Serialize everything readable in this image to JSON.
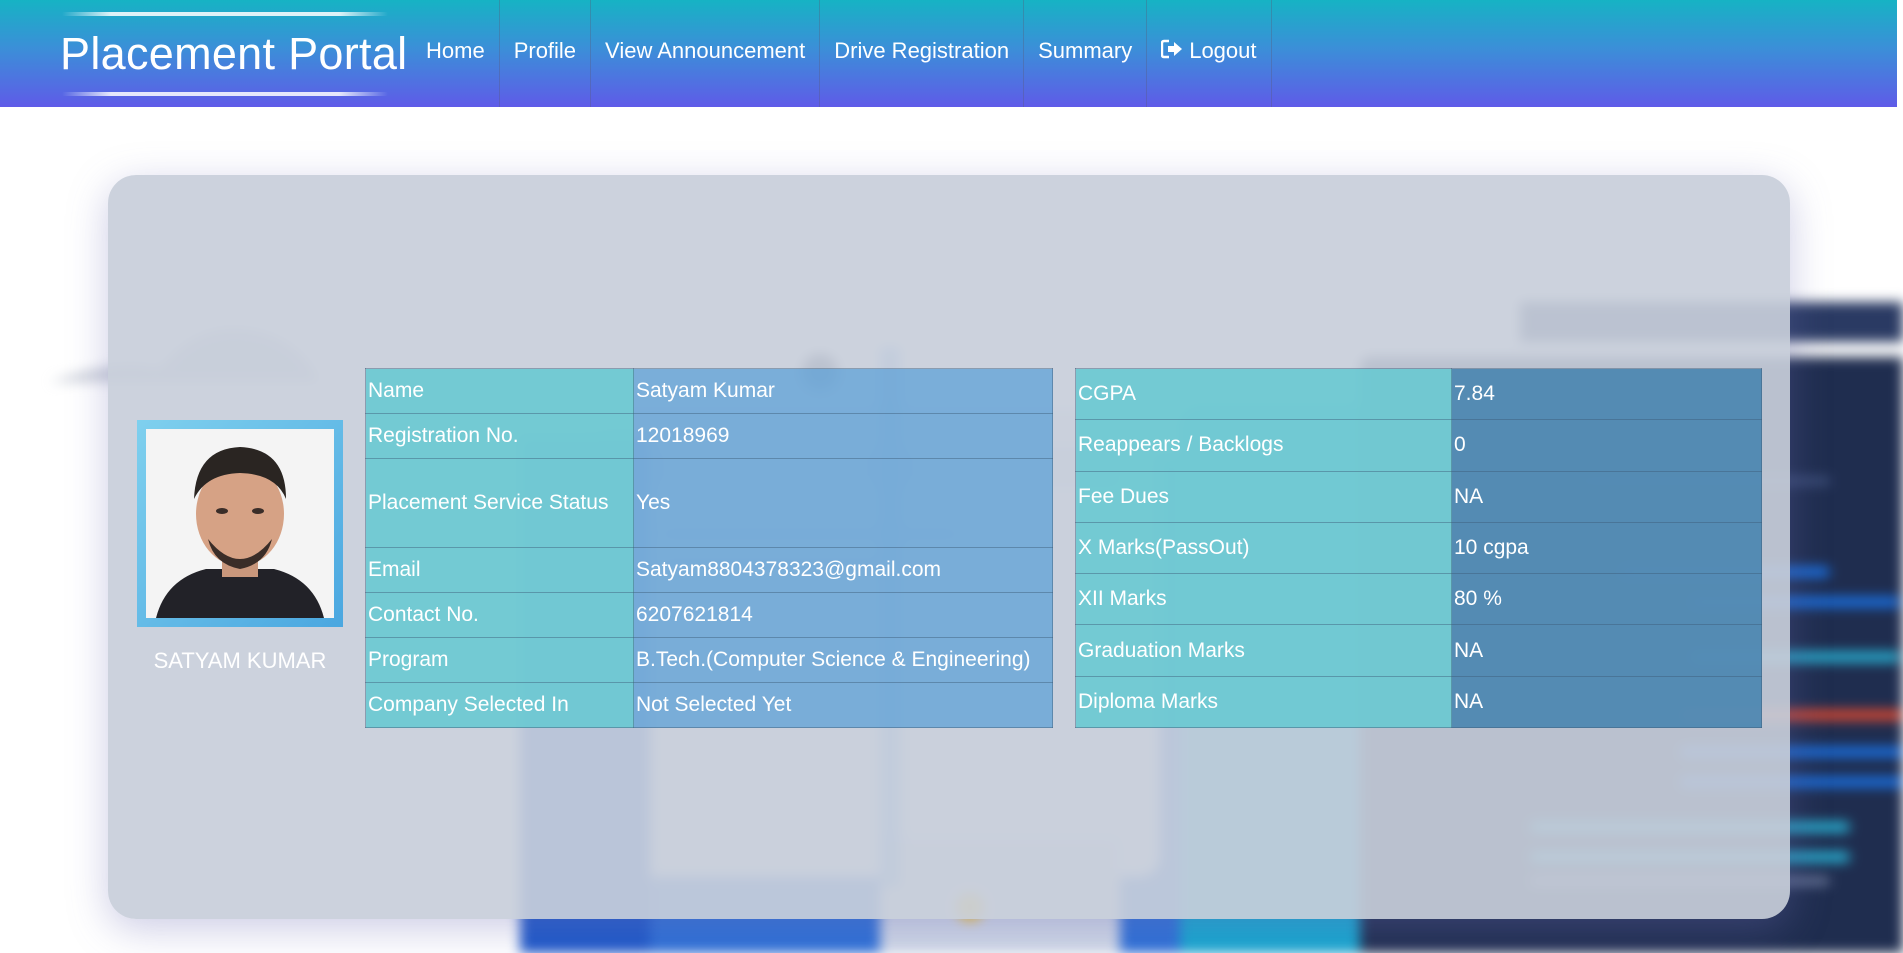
{
  "navbar": {
    "brand": "Placement Portal",
    "items": [
      {
        "label": "Home"
      },
      {
        "label": "Profile"
      },
      {
        "label": "View Announcement"
      },
      {
        "label": "Drive Registration"
      },
      {
        "label": "Summary"
      },
      {
        "label": "Logout",
        "icon": "logout-icon"
      }
    ],
    "colors": {
      "gradient_top": "#16b3c4",
      "gradient_bottom": "#5f5be8"
    }
  },
  "profile": {
    "display_name": "SATYAM KUMAR",
    "photo_icon": "avatar-photo"
  },
  "personal_details": [
    {
      "label": "Name",
      "value": "Satyam Kumar"
    },
    {
      "label": "Registration No.",
      "value": "12018969"
    },
    {
      "label": "Placement Service Status",
      "value": "Yes"
    },
    {
      "label": "Email",
      "value": "Satyam8804378323@gmail.com"
    },
    {
      "label": "Contact No.",
      "value": "6207621814"
    },
    {
      "label": "Program",
      "value": "B.Tech.(Computer Science & Engineering)"
    },
    {
      "label": "Company Selected In",
      "value": "Not Selected Yet"
    }
  ],
  "academic_details": [
    {
      "label": "CGPA",
      "value": "7.84"
    },
    {
      "label": "Reappears / Backlogs",
      "value": "0"
    },
    {
      "label": "Fee Dues",
      "value": "NA"
    },
    {
      "label": "X Marks(PassOut)",
      "value": "10 cgpa"
    },
    {
      "label": "XII Marks",
      "value": "80 %"
    },
    {
      "label": "Graduation Marks",
      "value": "NA"
    },
    {
      "label": "Diploma Marks",
      "value": "NA"
    }
  ]
}
